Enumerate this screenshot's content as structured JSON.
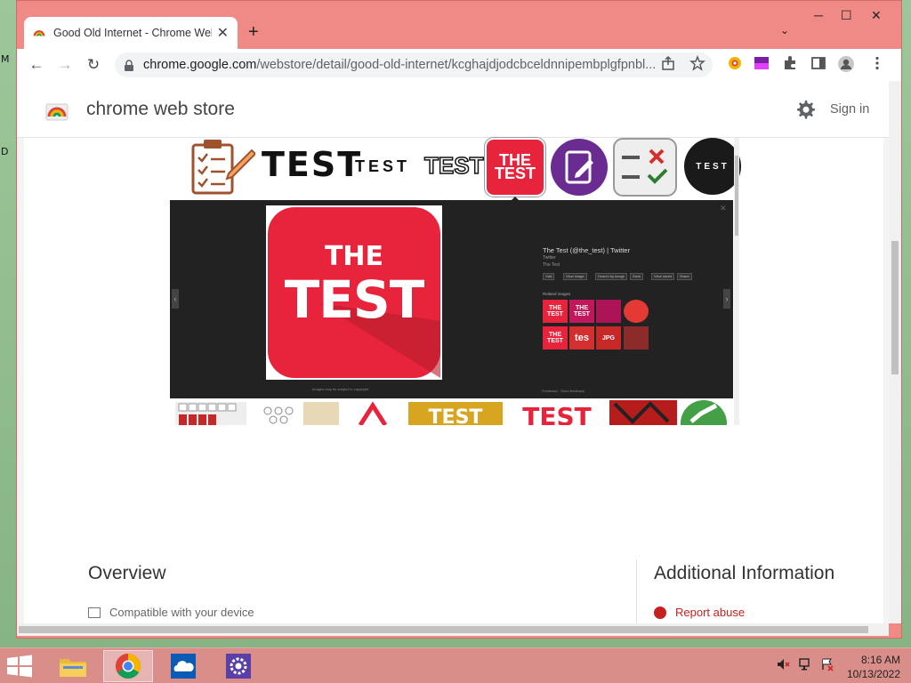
{
  "desktop": {
    "letters": [
      "M",
      "D"
    ]
  },
  "browser": {
    "tab": {
      "title": "Good Old Internet - Chrome Web Store",
      "close": "✕"
    },
    "new_tab": "+",
    "tab_search": "⌄",
    "window_controls": {
      "minimize": "─",
      "maximize": "☐",
      "close": "✕"
    },
    "nav": {
      "back": "←",
      "forward": "→",
      "reload": "↻"
    },
    "url": {
      "host": "chrome.google.com",
      "path": "/webstore/detail/good-old-internet/kcghajdjodcbceldnnipembplgfpnbl..."
    },
    "toolbar_icons": [
      "share-icon",
      "bookmark-star-icon",
      "extension-icon-1",
      "extension-icon-2",
      "extensions-puzzle-icon",
      "side-panel-icon",
      "profile-icon",
      "menu-icon"
    ]
  },
  "store": {
    "title": "chrome web store",
    "sign_in": "Sign in",
    "gallery": {
      "strip_top": [
        "TEST",
        "TEST",
        "TEST",
        "THE TEST"
      ],
      "viewer": {
        "big_image_line1": "THE",
        "big_image_line2": "TEST",
        "twitter_title": "The Test (@the_test) | Twitter",
        "twitter_sub": "Twitter",
        "twitter_sub2": "The Test",
        "buttons": [
          "Visit",
          "View image",
          "Search by image",
          "Save",
          "View saved",
          "Share"
        ],
        "related_label": "Related images",
        "related": [
          "THE TEST",
          "THE TEST",
          "",
          "",
          "THE TEST",
          "tes",
          "JPG",
          ""
        ],
        "footer": "Images may be subject to copyright",
        "footer2": "Feedback · Send feedback"
      }
    },
    "overview": "Overview",
    "compat": "Compatible with your device",
    "additional": "Additional Information",
    "report": "Report abuse"
  },
  "taskbar": {
    "apps": [
      "file-explorer",
      "chrome",
      "onedrive",
      "settings"
    ],
    "time": "8:16 AM",
    "date": "10/13/2022"
  },
  "colors": {
    "window_frame": "#ef8a87",
    "taskbar": "#d98e8a",
    "test_red": "#e8233c",
    "viewer_bg": "#222222"
  }
}
